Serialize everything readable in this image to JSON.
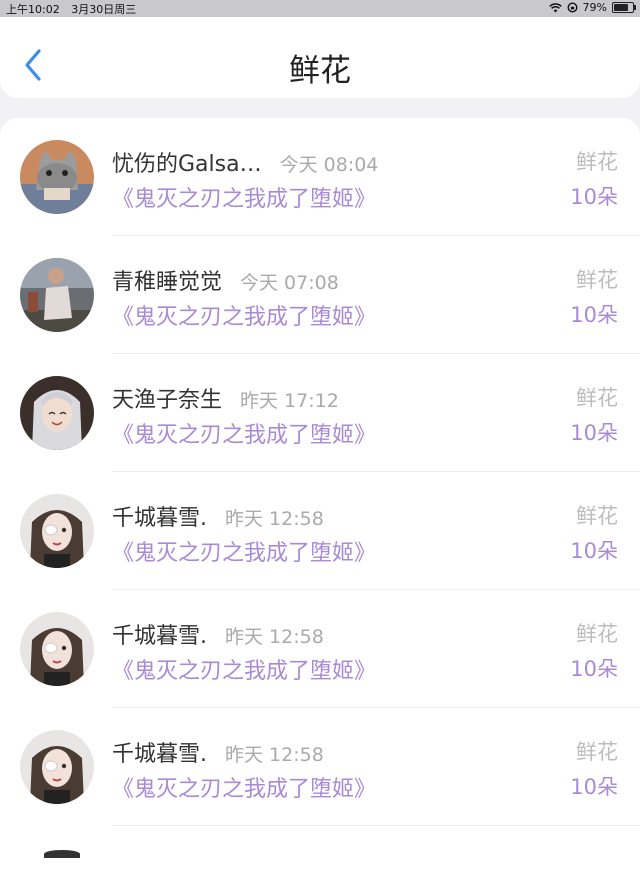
{
  "status": {
    "time": "上午10:02",
    "date": "3月30日周三",
    "battery": "79%",
    "battery_level": 0.79
  },
  "nav": {
    "title": "鲜花"
  },
  "rows": [
    {
      "name": "忧伤的Galsa…",
      "time": "今天 08:04",
      "book": "《鬼灭之刃之我成了堕姬》",
      "gift": "鲜花",
      "count": "10朵"
    },
    {
      "name": "青稚睡觉觉",
      "time": "今天 07:08",
      "book": "《鬼灭之刃之我成了堕姬》",
      "gift": "鲜花",
      "count": "10朵"
    },
    {
      "name": "天渔子奈生",
      "time": "昨天 17:12",
      "book": "《鬼灭之刃之我成了堕姬》",
      "gift": "鲜花",
      "count": "10朵"
    },
    {
      "name": "千城暮雪.",
      "time": "昨天 12:58",
      "book": "《鬼灭之刃之我成了堕姬》",
      "gift": "鲜花",
      "count": "10朵"
    },
    {
      "name": "千城暮雪.",
      "time": "昨天 12:58",
      "book": "《鬼灭之刃之我成了堕姬》",
      "gift": "鲜花",
      "count": "10朵"
    },
    {
      "name": "千城暮雪.",
      "time": "昨天 12:58",
      "book": "《鬼灭之刃之我成了堕姬》",
      "gift": "鲜花",
      "count": "10朵"
    }
  ],
  "colors": {
    "accent": "#a88ad6",
    "back": "#3b8ee8"
  }
}
